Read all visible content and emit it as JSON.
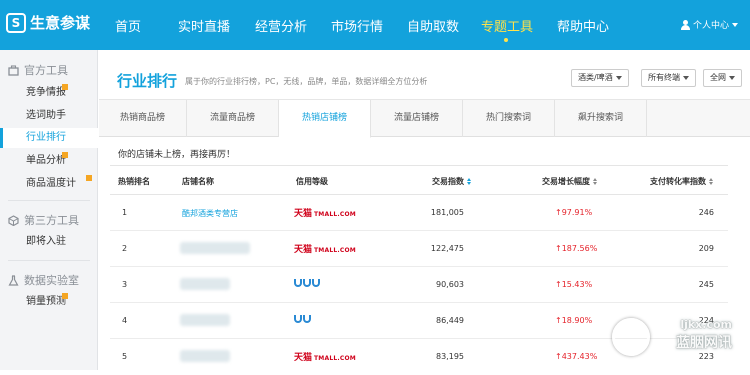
{
  "app": {
    "logo_text": "生意参谋",
    "logo_mark": "S"
  },
  "topnav": {
    "items": [
      "首页",
      "实时直播",
      "经营分析",
      "市场行情",
      "自助取数",
      "专题工具",
      "帮助中心"
    ],
    "active_index": 5,
    "user_label": "个人中心"
  },
  "sidebar": {
    "group_official": "官方工具",
    "official_items": [
      "竞争情报",
      "选词助手",
      "行业排行",
      "单品分析",
      "商品温度计"
    ],
    "group_third": "第三方工具",
    "third_items": [
      "即将入驻"
    ],
    "group_lab": "数据实验室",
    "lab_items": [
      "销量预测"
    ],
    "active_item": "行业排行"
  },
  "header": {
    "title": "行业排行",
    "subtitle": "属于你的行业排行榜，PC，无线，品牌，单品，数据详细全方位分析",
    "select_category": "酒类/啤酒",
    "select_terminal": "所有终端",
    "select_scope": "全网"
  },
  "tabs": {
    "items": [
      "热销商品榜",
      "流量商品榜",
      "热销店铺榜",
      "流量店铺榜",
      "热门搜索词",
      "飙升搜索词"
    ],
    "active_index": 2
  },
  "notice": "你的店铺未上榜，再接再厉！",
  "table": {
    "columns": [
      "热销排名",
      "店铺名称",
      "信用等级",
      "交易指数",
      "交易增长幅度",
      "支付转化率指数"
    ],
    "rows": [
      {
        "rank": "1",
        "name": "酷邦酒类专营店",
        "credit": "tmall",
        "trade": "181,005",
        "growth": "97.91%",
        "conversion": "246"
      },
      {
        "rank": "2",
        "name": "",
        "credit": "tmall",
        "trade": "122,475",
        "growth": "187.56%",
        "conversion": "209"
      },
      {
        "rank": "3",
        "name": "",
        "credit": "crown3",
        "trade": "90,603",
        "growth": "15.43%",
        "conversion": "245"
      },
      {
        "rank": "4",
        "name": "",
        "credit": "crown2",
        "trade": "86,449",
        "growth": "18.90%",
        "conversion": "224"
      },
      {
        "rank": "5",
        "name": "",
        "credit": "tmall",
        "trade": "83,195",
        "growth": "437.43%",
        "conversion": "223"
      }
    ]
  },
  "credit_labels": {
    "tmall_cn": "天猫",
    "tmall_en": "TMALL.COM"
  },
  "watermark": {
    "line1": "ljkx.com",
    "line2": "蓝胭网讯"
  },
  "colors": {
    "brand": "#13a2dc",
    "active_nav": "#ffe24a",
    "growth_up": "#e5232b",
    "tmall": "#d0021b"
  }
}
